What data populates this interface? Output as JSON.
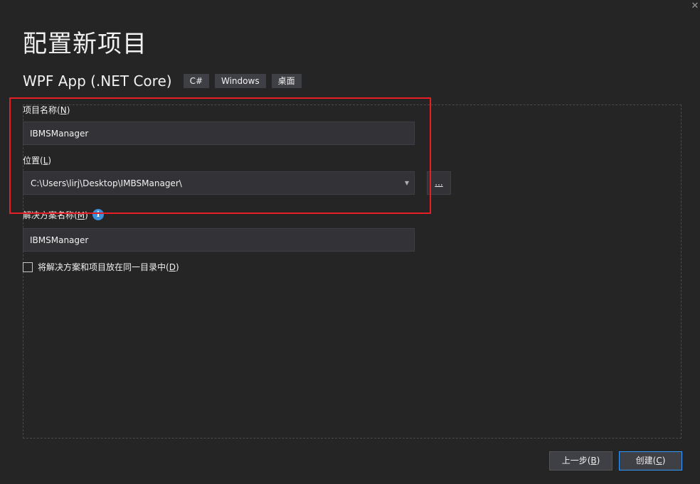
{
  "window": {
    "close_glyph": "✕"
  },
  "page": {
    "title": "配置新项目"
  },
  "template": {
    "name": "WPF App (.NET Core)",
    "tags": [
      "C#",
      "Windows",
      "桌面"
    ]
  },
  "project_name": {
    "label": "项目名称",
    "accel": "N",
    "value": "IBMSManager"
  },
  "location": {
    "label": "位置",
    "accel": "L",
    "value": "C:\\Users\\lirj\\Desktop\\IMBSManager\\",
    "browse_label": "..."
  },
  "solution_name": {
    "label": "解决方案名称",
    "accel": "M",
    "value": "IBMSManager",
    "info_glyph": "i"
  },
  "same_directory": {
    "label": "将解决方案和项目放在同一目录中",
    "accel": "D",
    "checked": false
  },
  "footer": {
    "back_label": "上一步",
    "back_accel": "B",
    "create_label": "创建",
    "create_accel": "C"
  },
  "colors": {
    "background": "#252526",
    "input_background": "#333337",
    "highlight_border": "#e81e25",
    "focus_border": "#3399ff",
    "info_icon": "#3c8fd8"
  }
}
